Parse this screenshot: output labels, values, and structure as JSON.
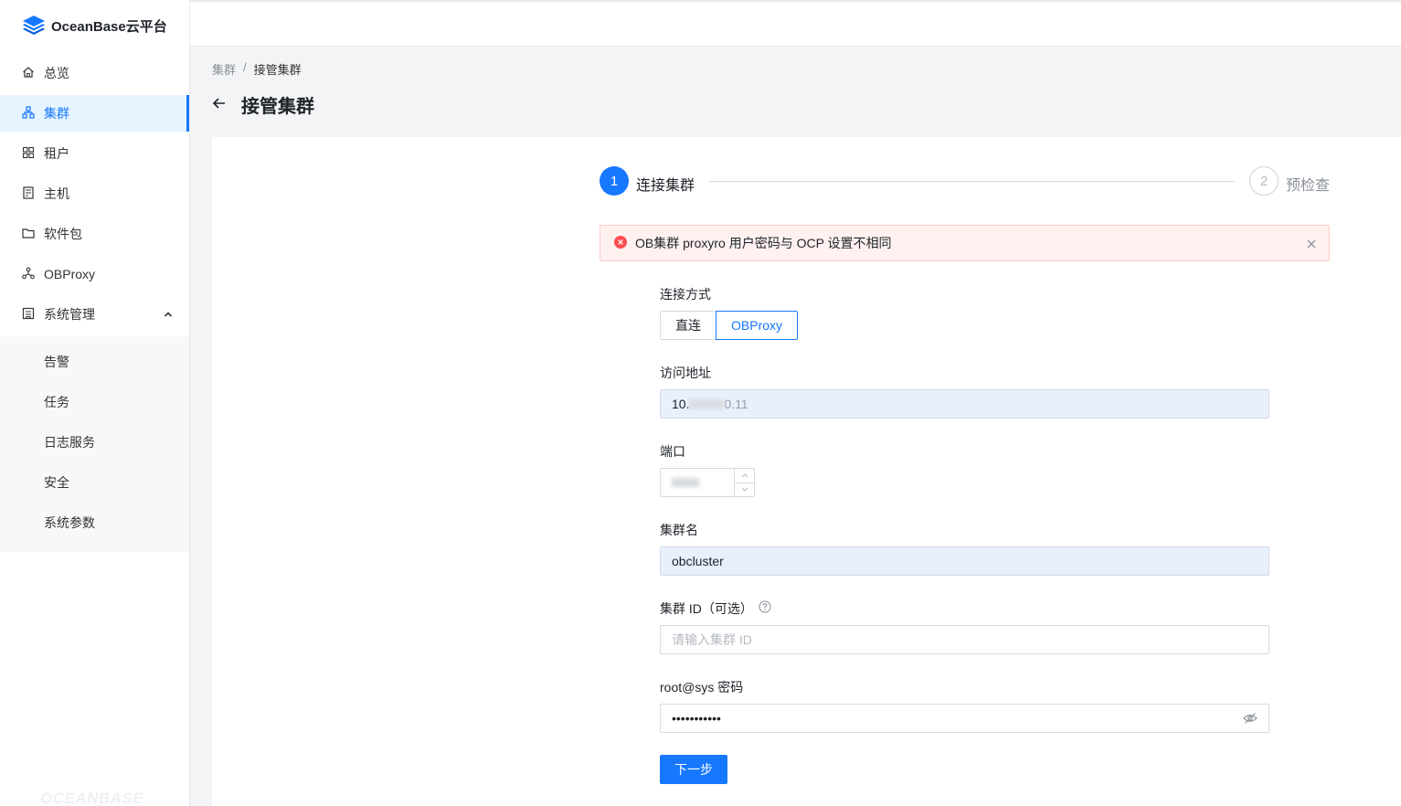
{
  "app": {
    "logo_text": "OceanBase云平台",
    "watermark": "OCEANBASE"
  },
  "sidebar": {
    "items": [
      {
        "label": "总览",
        "icon": "home-icon"
      },
      {
        "label": "集群",
        "icon": "cluster-icon",
        "active": true
      },
      {
        "label": "租户",
        "icon": "tenant-icon"
      },
      {
        "label": "主机",
        "icon": "host-icon"
      },
      {
        "label": "软件包",
        "icon": "folder-icon"
      },
      {
        "label": "OBProxy",
        "icon": "proxy-icon"
      },
      {
        "label": "系统管理",
        "icon": "system-icon",
        "expanded": true
      }
    ],
    "sub_items": [
      {
        "label": "告警"
      },
      {
        "label": "任务"
      },
      {
        "label": "日志服务"
      },
      {
        "label": "安全"
      },
      {
        "label": "系统参数"
      }
    ]
  },
  "breadcrumb": {
    "parent": "集群",
    "separator": "/",
    "current": "接管集群"
  },
  "page": {
    "title": "接管集群"
  },
  "steps": [
    {
      "number": "1",
      "label": "连接集群",
      "status": "current"
    },
    {
      "number": "2",
      "label": "预检查",
      "status": "waiting"
    }
  ],
  "alert": {
    "message": "OB集群 proxyro 用户密码与 OCP 设置不相同",
    "type": "error"
  },
  "form": {
    "connection": {
      "label": "连接方式",
      "options": [
        "直连",
        "OBProxy"
      ],
      "selected": "OBProxy"
    },
    "address": {
      "label": "访问地址",
      "value_prefix": "10.",
      "value_suffix": "0.11"
    },
    "port": {
      "label": "端口"
    },
    "cluster_name": {
      "label": "集群名",
      "value": "obcluster"
    },
    "cluster_id": {
      "label": "集群 ID（可选）",
      "placeholder": "请输入集群 ID"
    },
    "password": {
      "label": "root@sys 密码",
      "value": "•••••••••••"
    },
    "next_label": "下一步"
  },
  "colors": {
    "primary": "#1677ff",
    "error": "#ff4d4f",
    "alert_bg": "#fff1f0"
  }
}
